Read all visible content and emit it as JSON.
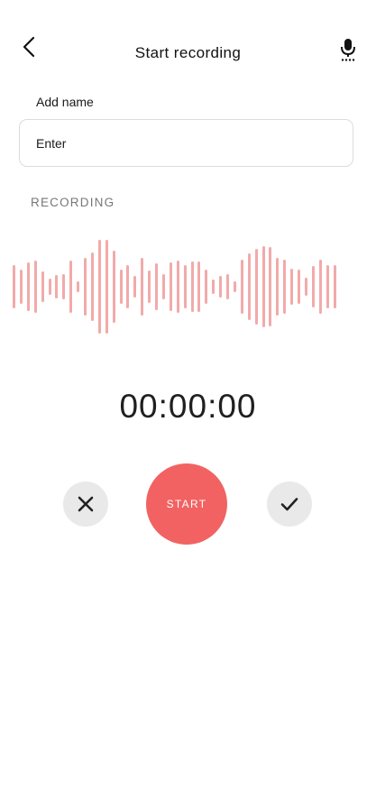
{
  "header": {
    "title": "Start recording",
    "back_icon": "chevron-left-icon",
    "mic_icon": "microphone-icon"
  },
  "name_input": {
    "label": "Add name",
    "placeholder": "Enter",
    "value": ""
  },
  "section_label": "RECORDING",
  "timer": "00:00:00",
  "controls": {
    "cancel_icon": "close-icon",
    "start_label": "START",
    "confirm_icon": "check-icon"
  },
  "colors": {
    "accent": "#f26262",
    "waveform": "#f2aaaa",
    "secondary_button": "#e9e9e9",
    "text_muted": "#777777"
  },
  "waveform_levels": [
    0.37,
    0.29,
    0.42,
    0.45,
    0.27,
    0.14,
    0.2,
    0.22,
    0.45,
    0.1,
    0.5,
    0.6,
    0.81,
    0.82,
    0.62,
    0.29,
    0.38,
    0.18,
    0.5,
    0.28,
    0.4,
    0.22,
    0.42,
    0.45,
    0.38,
    0.43,
    0.43,
    0.3,
    0.13,
    0.18,
    0.22,
    0.1,
    0.47,
    0.58,
    0.65,
    0.7,
    0.68,
    0.5,
    0.47,
    0.32,
    0.3,
    0.15,
    0.36,
    0.47,
    0.38,
    0.37
  ]
}
